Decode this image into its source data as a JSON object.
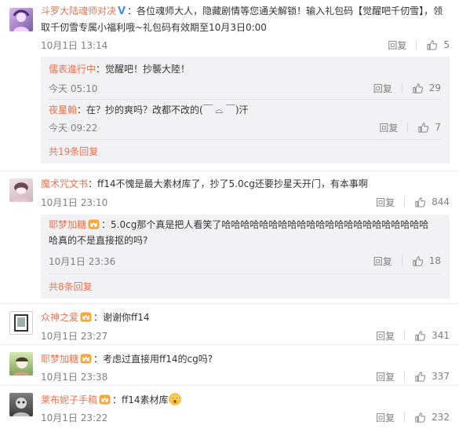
{
  "comments": [
    {
      "user": "斗罗大陆魂师对决",
      "text": "：各位魂师大人，隐藏剧情等您通关解锁！输入礼包码【觉醒吧千仞雪】，领取千仞雪专属小福利哦~礼包码有效期至10月3日0:00",
      "time": "10月1日 13:14",
      "reply_label": "回复",
      "likes": "5",
      "replies": [
        {
          "user": "儒表進行中",
          "text": "：觉醒吧！抄襲大陸！",
          "time": "今天 05:10",
          "reply_label": "回复",
          "likes": "29"
        },
        {
          "user": "夜星翰",
          "text": "：在？抄的爽吗？改都不改的(￣ ⌓ ￣)汗",
          "time": "今天 09:22",
          "reply_label": "回复",
          "likes": "7"
        }
      ],
      "more": "共19条回复"
    },
    {
      "user": "魔术咒文书",
      "text": "：ff14不愧是最大素材库了，抄了5.0cg还要抄星天开门，有本事啊",
      "time": "10月1日 23:10",
      "reply_label": "回复",
      "likes": "844",
      "replies": [
        {
          "user": "耶梦加糖",
          "text": "：5.0cg那个真是把人看笑了哈哈哈哈哈哈哈哈哈哈哈哈哈哈哈哈哈哈哈哈哈哈哈真的不是直接抠的吗?",
          "time": "10月1日 23:36",
          "reply_label": "回复",
          "likes": "18"
        }
      ],
      "more": "共8条回复"
    },
    {
      "user": "众神之爱",
      "text": "：谢谢你ff14",
      "time": "10月1日 23:27",
      "reply_label": "回复",
      "likes": "341"
    },
    {
      "user": "耶梦加糖",
      "text": "：考虑过直接用ff14的cg吗?",
      "time": "10月1日 23:38",
      "reply_label": "回复",
      "likes": "337"
    },
    {
      "user": "莱布妮子手稿",
      "text": "：ff14素材库",
      "time": "10月1日 23:22",
      "reply_label": "回复",
      "likes": "232"
    }
  ],
  "colors": {
    "username": "#eb7350",
    "meta": "#808080",
    "reply_bg": "#f2f2f5",
    "verified": "#4a90e2"
  },
  "icons": [
    "verified-v-icon",
    "crown-badge-icon",
    "thumbs-up-icon",
    "surprised-emoji-icon"
  ]
}
